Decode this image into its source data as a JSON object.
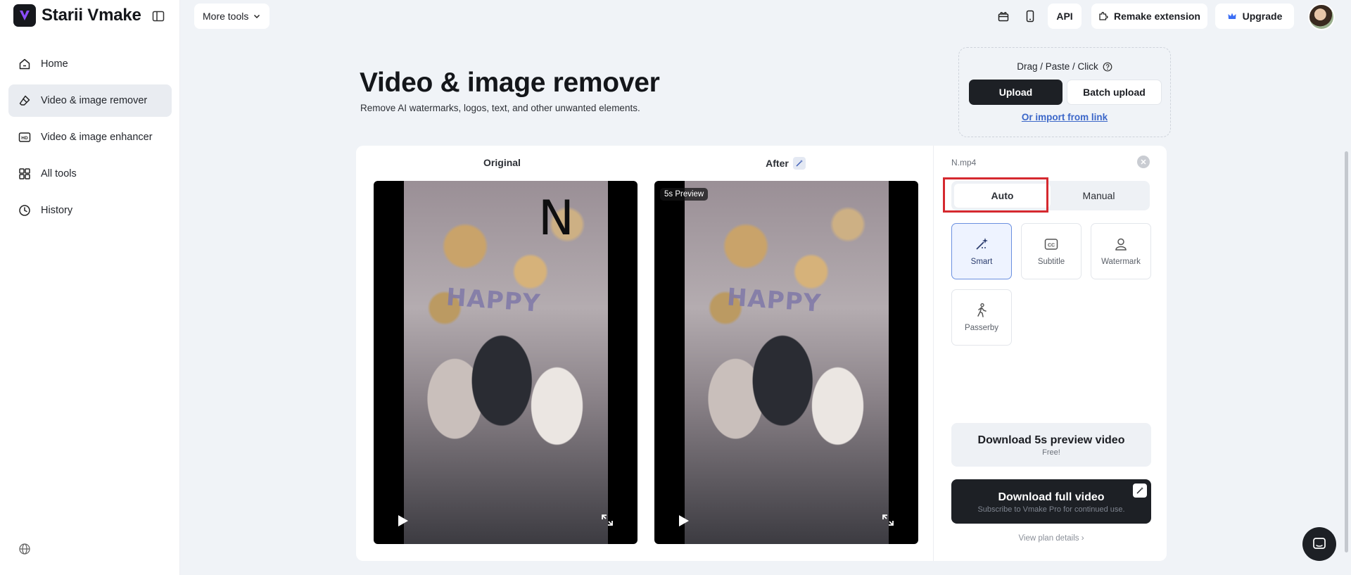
{
  "app": {
    "name": "Starii Vmake",
    "brand_color": "#7b3ff2"
  },
  "sidebar": {
    "items": [
      {
        "label": "Home",
        "icon": "home-icon"
      },
      {
        "label": "Video & image remover",
        "icon": "eraser-icon",
        "active": true
      },
      {
        "label": "Video & image enhancer",
        "icon": "hd-icon"
      },
      {
        "label": "All tools",
        "icon": "grid-icon"
      },
      {
        "label": "History",
        "icon": "clock-icon"
      }
    ]
  },
  "topbar": {
    "more_tools": "More tools",
    "api": "API",
    "remake_extension": "Remake extension",
    "upgrade": "Upgrade"
  },
  "header": {
    "title": "Video & image remover",
    "subtitle": "Remove AI watermarks, logos, text, and other unwanted elements."
  },
  "upload": {
    "hint": "Drag / Paste / Click",
    "upload_label": "Upload",
    "batch_label": "Batch upload",
    "import_link": "Or import from link"
  },
  "preview": {
    "original_label": "Original",
    "after_label": "After",
    "preview_badge": "5s Preview",
    "watermark_letter": "N",
    "balloon_text": "HAPPY"
  },
  "panel": {
    "file_name": "N.mp4",
    "modes": [
      "Auto",
      "Manual"
    ],
    "active_mode": "Auto",
    "tools": [
      {
        "label": "Smart",
        "icon": "magic-wand-icon",
        "active": true
      },
      {
        "label": "Subtitle",
        "icon": "cc-icon"
      },
      {
        "label": "Watermark",
        "icon": "user-icon"
      },
      {
        "label": "Passerby",
        "icon": "walking-person-icon"
      }
    ],
    "download_preview": {
      "title": "Download 5s preview video",
      "sub": "Free!"
    },
    "download_full": {
      "title": "Download full video",
      "sub": "Subscribe to Vmake Pro for continued use."
    },
    "plan_details": "View plan details ›"
  }
}
